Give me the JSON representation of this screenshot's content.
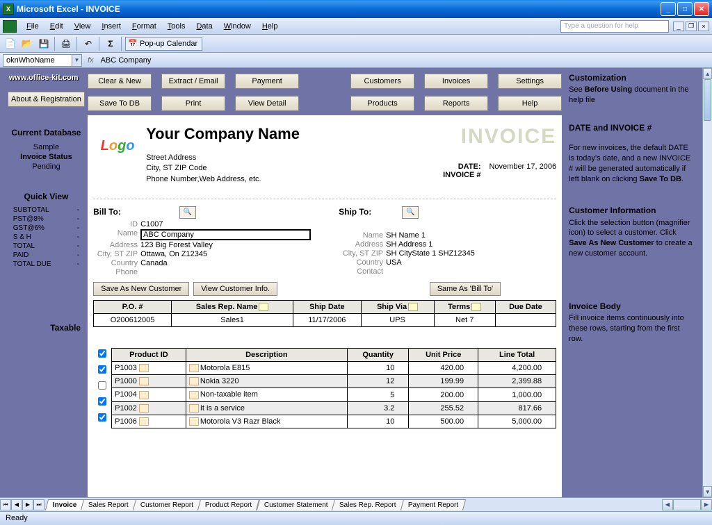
{
  "titlebar": {
    "app": "Microsoft Excel",
    "doc": "INVOICE"
  },
  "menubar": {
    "items": [
      "File",
      "Edit",
      "View",
      "Insert",
      "Format",
      "Tools",
      "Data",
      "Window",
      "Help"
    ],
    "help_placeholder": "Type a question for help"
  },
  "toolbar": {
    "popup_label": "Pop-up Calendar"
  },
  "formula": {
    "namebox": "oknWhoName",
    "fx": "fx",
    "value": "ABC Company"
  },
  "left": {
    "site": "www.office-kit.com",
    "about_btn": "About & Registration",
    "db_header": "Current Database",
    "db_name": "Sample",
    "status_label": "Invoice Status",
    "status_value": "Pending",
    "qv_header": "Quick View",
    "qv_rows": [
      {
        "label": "SUBTOTAL",
        "value": "-"
      },
      {
        "label": "PST@8%",
        "value": "-"
      },
      {
        "label": "GST@6%",
        "value": "-"
      },
      {
        "label": "S & H",
        "value": "-"
      },
      {
        "label": "TOTAL",
        "value": "-"
      },
      {
        "label": "PAID",
        "value": "-"
      },
      {
        "label": "TOTAL DUE",
        "value": "-"
      }
    ],
    "taxable": "Taxable"
  },
  "buttons": {
    "row1_left": [
      "Clear & New",
      "Extract / Email",
      "Payment"
    ],
    "row1_right": [
      "Customers",
      "Invoices",
      "Settings"
    ],
    "row2_left": [
      "Save To DB",
      "Print",
      "View Detail"
    ],
    "row2_right": [
      "Products",
      "Reports",
      "Help"
    ]
  },
  "company": {
    "name": "Your Company Name",
    "addr1": "Street Address",
    "addr2": "City, ST  ZIP Code",
    "addr3": "Phone Number,Web Address, etc."
  },
  "invoice": {
    "title": "INVOICE",
    "date_label": "DATE:",
    "date_value": "November 17, 2006",
    "num_label": "INVOICE #"
  },
  "billto": {
    "header": "Bill To:",
    "labels": {
      "id": "ID",
      "name": "Name",
      "address": "Address",
      "csz": "City, ST ZIP",
      "country": "Country",
      "phone": "Phone"
    },
    "id": "C1007",
    "name": "ABC Company",
    "address": "123 Big Forest Valley",
    "csz": "Ottawa, On Z12345",
    "country": "Canada",
    "phone": ""
  },
  "shipto": {
    "header": "Ship To:",
    "labels": {
      "name": "Name",
      "address": "Address",
      "csz": "City, ST ZIP",
      "country": "Country",
      "contact": "Contact"
    },
    "name": "SH Name 1",
    "address": "SH Address 1",
    "csz": "SH CityState 1 SHZ12345",
    "country": "USA",
    "contact": ""
  },
  "cust_buttons": {
    "save_new": "Save As New Customer",
    "view_info": "View Customer Info.",
    "same_as": "Same As 'Bill To'"
  },
  "order": {
    "headers": [
      "P.O. #",
      "Sales Rep. Name",
      "Ship Date",
      "Ship Via",
      "Terms",
      "Due Date"
    ],
    "row": [
      "O200612005",
      "Sales1",
      "11/17/2006",
      "UPS",
      "Net 7",
      ""
    ]
  },
  "items": {
    "headers": [
      "Product ID",
      "Description",
      "Quantity",
      "Unit Price",
      "Line Total"
    ],
    "rows": [
      {
        "taxable": true,
        "pid": "P1003",
        "desc": "Motorola E815",
        "qty": "10",
        "price": "420.00",
        "total": "4,200.00"
      },
      {
        "taxable": true,
        "pid": "P1000",
        "desc": "Nokia 3220",
        "qty": "12",
        "price": "199.99",
        "total": "2,399.88"
      },
      {
        "taxable": false,
        "pid": "P1004",
        "desc": "Non-taxable  item",
        "qty": "5",
        "price": "200.00",
        "total": "1,000.00"
      },
      {
        "taxable": true,
        "pid": "P1002",
        "desc": "It is a service",
        "qty": "3.2",
        "price": "255.52",
        "total": "817.66"
      },
      {
        "taxable": true,
        "pid": "P1006",
        "desc": "Motorola V3 Razr Black",
        "qty": "10",
        "price": "500.00",
        "total": "5,000.00"
      }
    ]
  },
  "right": {
    "custom_title": "Customization",
    "custom_body_1": "See ",
    "custom_bold": "Before Using",
    "custom_body_2": " document in the help file",
    "date_title": "DATE and INVOICE #",
    "date_body_1": "For new invoices, the default DATE is today's date, and a new INVOICE # will be generated automatically if left blank on clicking ",
    "date_bold": "Save To DB",
    "date_body_2": ".",
    "cust_title": "Customer Information",
    "cust_body_1": "Click the selection button (magnifier icon) to select a customer. Click ",
    "cust_bold": "Save As New Customer",
    "cust_body_2": " to create a new customer account.",
    "body_title": "Invoice Body",
    "body_text": "Fill invoice items continuously into these rows, starting from the first row."
  },
  "tabs": [
    "Invoice",
    "Sales Report",
    "Customer Report",
    "Product Report",
    "Customer Statement",
    "Sales Rep. Report",
    "Payment Report"
  ],
  "status": "Ready"
}
